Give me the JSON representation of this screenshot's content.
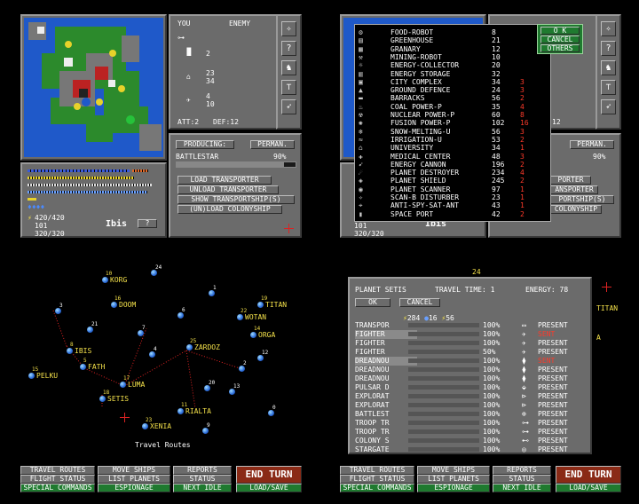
{
  "q1": {
    "vs_you": "YOU",
    "vs_enemy": "ENEMY",
    "you_counts": [
      "2",
      "23",
      "4"
    ],
    "enemy_counts": [
      "34",
      "10"
    ],
    "att": "ATT:2",
    "def": "DEF:12",
    "producing_label": "PRODUCING:",
    "perman_label": "PERMAN.",
    "product": "BATTLESTAR",
    "product_pct": "90%",
    "product_progress": 0.9,
    "actions": [
      "LOAD TRANSPORTER",
      "UNLOAD TRANSPORTER",
      "SHOW TRANSPORTSHIP(S)",
      "(UN)LOAD COLONYSHIP"
    ],
    "res_1": "420/420",
    "res_2": "101",
    "res_3": "320/320",
    "planet_name": "Ibis",
    "help": "?"
  },
  "q2": {
    "build_items": [
      {
        "name": "FOOD-ROBOT",
        "c1": "8",
        "c2": ""
      },
      {
        "name": "GREENHOUSE",
        "c1": "21",
        "c2": ""
      },
      {
        "name": "GRANARY",
        "c1": "12",
        "c2": ""
      },
      {
        "name": "MINING-ROBOT",
        "c1": "10",
        "c2": ""
      },
      {
        "name": "ENERGY-COLLECTOR",
        "c1": "20",
        "c2": ""
      },
      {
        "name": "ENERGY STORAGE",
        "c1": "32",
        "c2": ""
      },
      {
        "name": "CITY COMPLEX",
        "c1": "34",
        "c2": "3"
      },
      {
        "name": "GROUND DEFENCE",
        "c1": "24",
        "c2": "3"
      },
      {
        "name": "BARRACKS",
        "c1": "56",
        "c2": "2"
      },
      {
        "name": "COAL POWER-P",
        "c1": "35",
        "c2": "4"
      },
      {
        "name": "NUCLEAR POWER-P",
        "c1": "60",
        "c2": "8"
      },
      {
        "name": "FUSION POWER-P",
        "c1": "102",
        "c2": "16"
      },
      {
        "name": "SNOW-MELTING-U",
        "c1": "56",
        "c2": "3"
      },
      {
        "name": "IRRIGATION-U",
        "c1": "53",
        "c2": "2"
      },
      {
        "name": "UNIVERSITY",
        "c1": "34",
        "c2": "1"
      },
      {
        "name": "MEDICAL CENTER",
        "c1": "48",
        "c2": "3"
      },
      {
        "name": "ENERGY CANNON",
        "c1": "196",
        "c2": "2"
      },
      {
        "name": "PLANET DESTROYER",
        "c1": "234",
        "c2": "4"
      },
      {
        "name": "PLANET SHIELD",
        "c1": "245",
        "c2": "2"
      },
      {
        "name": "PLANET SCANNER",
        "c1": "97",
        "c2": "1"
      },
      {
        "name": "SCAN-B DISTURBER",
        "c1": "23",
        "c2": "1"
      },
      {
        "name": "ANTI-SPY-SAT-ANT",
        "c1": "43",
        "c2": "1"
      },
      {
        "name": "SPACE PORT",
        "c1": "42",
        "c2": "2"
      }
    ],
    "ok": "O K",
    "cancel": "CANCEL",
    "others": "OTHERS",
    "att_frag": "12",
    "perman": "PERMAN.",
    "pct": "90%",
    "act_frags": [
      "PORTER",
      "ANSPORTER",
      "PORTSHIP(S)",
      "COLONYSHIP"
    ],
    "res_2": "101",
    "res_3": "320/320",
    "planet_name": "Ibis"
  },
  "q3": {
    "caption": "Travel Routes",
    "planets": [
      {
        "name": "KORG",
        "num": "10"
      },
      {
        "name": "DOOM",
        "num": "16"
      },
      {
        "name": "TITAN",
        "num": "19"
      },
      {
        "name": "WOTAN",
        "num": "22"
      },
      {
        "name": "ORGA",
        "num": "14"
      },
      {
        "name": "ZARDOZ",
        "num": "25"
      },
      {
        "name": "IBIS",
        "num": "8"
      },
      {
        "name": "FATH",
        "num": "5"
      },
      {
        "name": "PELKU",
        "num": "15"
      },
      {
        "name": "LUMA",
        "num": "17"
      },
      {
        "name": "SETIS",
        "num": "18"
      },
      {
        "name": "RIALTA",
        "num": "11"
      },
      {
        "name": "XENIA",
        "num": "23"
      }
    ],
    "lone_nums": [
      "24",
      "1",
      "3",
      "6",
      "21",
      "7",
      "4",
      "12",
      "2",
      "13",
      "20",
      "0",
      "9"
    ]
  },
  "q4": {
    "title": "PLANET SETIS",
    "travel": "TRAVEL TIME: 1",
    "energy": "ENERGY: 78",
    "ok": "OK",
    "cancel": "CANCEL",
    "transport_vals": [
      "284",
      "16",
      "56"
    ],
    "ships": [
      {
        "name": "TRANSPOR",
        "pct": "100%",
        "status": "PRESENT",
        "danger": false
      },
      {
        "name": "FIGHTER",
        "pct": "100%",
        "status": "SENT",
        "danger": true
      },
      {
        "name": "FIGHTER",
        "pct": "100%",
        "status": "PRESENT",
        "danger": false
      },
      {
        "name": "FIGHTER",
        "pct": "50%",
        "status": "PRESENT",
        "danger": false
      },
      {
        "name": "DREADNOU",
        "pct": "100%",
        "status": "SENT",
        "danger": true
      },
      {
        "name": "DREADNOU",
        "pct": "100%",
        "status": "PRESENT",
        "danger": false
      },
      {
        "name": "DREADNOU",
        "pct": "100%",
        "status": "PRESENT",
        "danger": false
      },
      {
        "name": "PULSAR D",
        "pct": "100%",
        "status": "PRESENT",
        "danger": false
      },
      {
        "name": "EXPLORAT",
        "pct": "100%",
        "status": "PRESENT",
        "danger": false
      },
      {
        "name": "EXPLORAT",
        "pct": "100%",
        "status": "PRESENT",
        "danger": false
      },
      {
        "name": "BATTLEST",
        "pct": "100%",
        "status": "PRESENT",
        "danger": false
      },
      {
        "name": "TROOP TR",
        "pct": "100%",
        "status": "PRESENT",
        "danger": false
      },
      {
        "name": "TROOP TR",
        "pct": "100%",
        "status": "PRESENT",
        "danger": false
      },
      {
        "name": "COLONY S",
        "pct": "100%",
        "status": "PRESENT",
        "danger": false
      },
      {
        "name": "STARGATE",
        "pct": "100%",
        "status": "PRESENT",
        "danger": false
      }
    ],
    "side_frags": [
      "TITAN",
      "A"
    ],
    "map_num": "24"
  },
  "bottom": {
    "row1": [
      "TRAVEL ROUTES",
      "MOVE SHIPS",
      "REPORTS"
    ],
    "row2": [
      "FLIGHT STATUS",
      "LIST PLANETS",
      "STATUS"
    ],
    "row3": [
      "SPECIAL COMMANDS",
      "ESPIONAGE",
      "NEXT IDLE"
    ],
    "end_turn": "END TURN",
    "load_save": "LOAD/SAVE"
  }
}
